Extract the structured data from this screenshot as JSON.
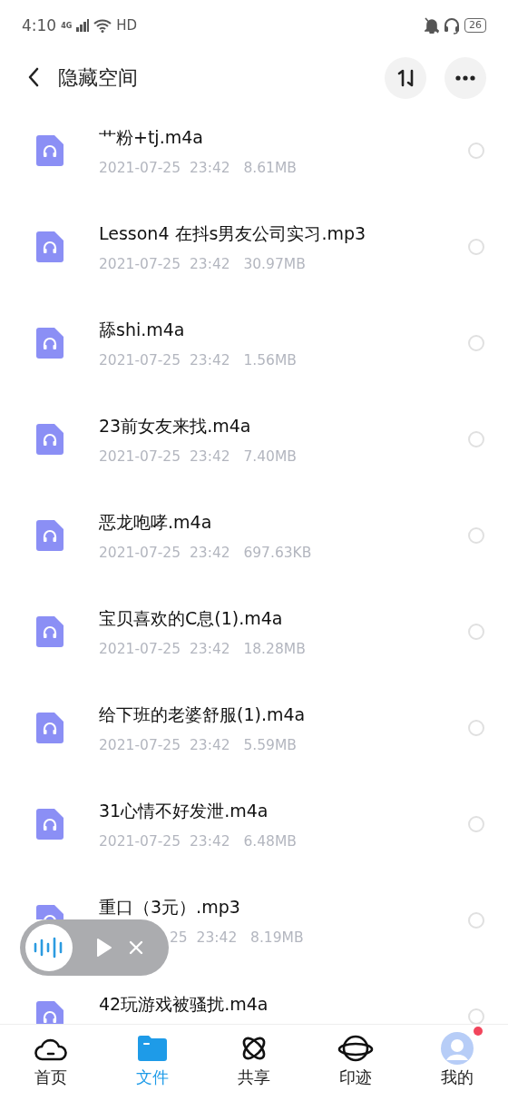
{
  "status_bar": {
    "time": "4:10",
    "network": "4G",
    "hd": "HD",
    "battery": "26"
  },
  "header": {
    "title": "隐藏空间"
  },
  "files": [
    {
      "kind": "full",
      "name": "艹粉+tj.m4a",
      "meta": "2021-07-25  23:42   8.61MB",
      "selected": false
    },
    {
      "kind": "full",
      "name": "Lesson4  在抖s男友公司实习.mp3",
      "meta": "2021-07-25  23:42   30.97MB",
      "selected": false
    },
    {
      "kind": "full",
      "name": "舔shi.m4a",
      "meta": "2021-07-25  23:42   1.56MB",
      "selected": false
    },
    {
      "kind": "full",
      "name": "23前女友来找.m4a",
      "meta": "2021-07-25  23:42   7.40MB",
      "selected": false
    },
    {
      "kind": "full",
      "name": "恶龙咆哮.m4a",
      "meta": "2021-07-25  23:42   697.63KB",
      "selected": false
    },
    {
      "kind": "full",
      "name": "宝贝喜欢的C息(1).m4a",
      "meta": "2021-07-25  23:42   18.28MB",
      "selected": false
    },
    {
      "kind": "full",
      "name": "给下班的老婆舒服(1).m4a",
      "meta": "2021-07-25  23:42   5.59MB",
      "selected": false
    },
    {
      "kind": "full",
      "name": "31心情不好发泄.m4a",
      "meta": "2021-07-25  23:42   6.48MB",
      "selected": false
    },
    {
      "kind": "covered",
      "name": "重口（3元）.mp3",
      "meta": "25  23:42   8.19MB",
      "selected": false
    },
    {
      "kind": "cut",
      "name": "42玩游戏被骚扰.m4a",
      "selected": false
    }
  ],
  "tabs": [
    {
      "kind": "home",
      "label": "首页",
      "selected": false,
      "badge": false
    },
    {
      "kind": "files",
      "label": "文件",
      "selected": true,
      "badge": false
    },
    {
      "kind": "share",
      "label": "共享",
      "selected": false,
      "badge": false
    },
    {
      "kind": "trace",
      "label": "印迹",
      "selected": false,
      "badge": false
    },
    {
      "kind": "me",
      "label": "我的",
      "selected": false,
      "badge": true
    }
  ]
}
